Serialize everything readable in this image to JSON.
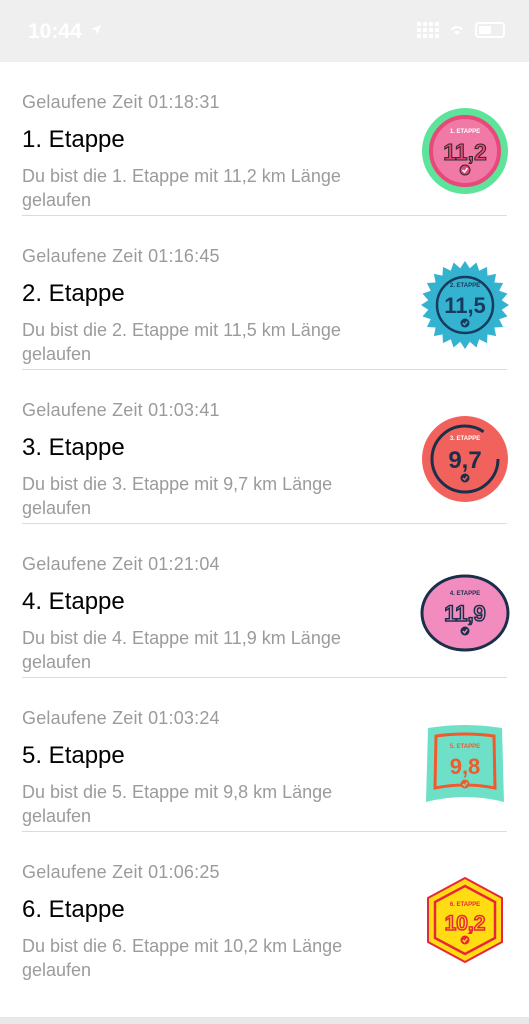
{
  "status": {
    "time": "10:44"
  },
  "colors": {
    "green": "#5de49a",
    "pink": "#e8487a",
    "teal": "#33b3cf",
    "navy": "#173a5e",
    "coral": "#f2625c",
    "rose": "#f28cbf",
    "mint": "#6ee0c8",
    "orange": "#f25a2c",
    "yellow": "#ffdd12",
    "red": "#e8263a"
  },
  "stages": [
    {
      "time": "Gelaufene Zeit 01:18:31",
      "title": "1. Etappe",
      "desc": "Du bist die 1. Etappe mit 11,2 km Länge gelaufen",
      "badge_label": "1. ETAPPE",
      "badge_km": "11,2"
    },
    {
      "time": "Gelaufene Zeit 01:16:45",
      "title": "2. Etappe",
      "desc": "Du bist die 2. Etappe mit 11,5 km Länge gelaufen",
      "badge_label": "2. ETAPPE",
      "badge_km": "11,5"
    },
    {
      "time": "Gelaufene Zeit 01:03:41",
      "title": "3. Etappe",
      "desc": "Du bist die 3. Etappe mit 9,7 km Länge gelaufen",
      "badge_label": "3. ETAPPE",
      "badge_km": "9,7"
    },
    {
      "time": "Gelaufene Zeit 01:21:04",
      "title": "4. Etappe",
      "desc": "Du bist die 4. Etappe mit 11,9 km Länge gelaufen",
      "badge_label": "4. ETAPPE",
      "badge_km": "11,9"
    },
    {
      "time": "Gelaufene Zeit 01:03:24",
      "title": "5. Etappe",
      "desc": "Du bist die 5. Etappe mit 9,8 km Länge gelaufen",
      "badge_label": "5. ETAPPE",
      "badge_km": "9,8"
    },
    {
      "time": "Gelaufene Zeit 01:06:25",
      "title": "6. Etappe",
      "desc": "Du bist die 6. Etappe mit 10,2 km Länge gelaufen",
      "badge_label": "6. ETAPPE",
      "badge_km": "10,2"
    }
  ]
}
